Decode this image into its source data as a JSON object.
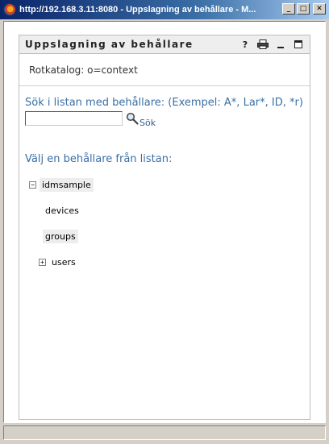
{
  "window": {
    "title": "http://192.168.3.11:8080 - Uppslagning av behållare - M...",
    "minimize_glyph": "_",
    "maximize_glyph": "□",
    "close_glyph": "✕"
  },
  "portlet": {
    "title": "Uppslagning av behållare",
    "icons": [
      "help-icon",
      "print-icon",
      "minimize-icon",
      "maximize-icon"
    ],
    "help_glyph": "?"
  },
  "root_catalog": "Rotkatalog: o=context",
  "search": {
    "label": "Sök i listan med behållare: (Exempel: A*, Lar*, ID, *r)",
    "value": "",
    "button_label": "Sök"
  },
  "choose_label": "Välj en behållare från listan:",
  "tree": {
    "root": {
      "label": "idmsample",
      "expander": "−"
    },
    "children": [
      {
        "label": "devices"
      },
      {
        "label": "groups"
      },
      {
        "label": "users",
        "expander": "+"
      }
    ]
  },
  "colors": {
    "accent_text": "#3a6fa5",
    "titlebar_start": "#0a246a",
    "titlebar_end": "#a6caf0"
  }
}
